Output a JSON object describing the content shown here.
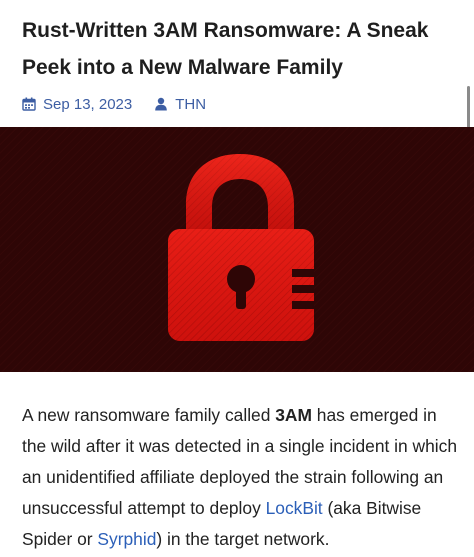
{
  "article": {
    "title_line1": "Rust-Written 3AM Ransomware: A Sneak",
    "title_line2": "Peek into a New Malware Family",
    "date": "Sep 13, 2023",
    "author": "THN",
    "date_icon": "calendar-icon",
    "author_icon": "user-icon"
  },
  "hero": {
    "icon": "padlock-icon",
    "background": "#2e0606",
    "lock_color": "#e0140f"
  },
  "paragraph": {
    "part1": "A new ransomware family called ",
    "bold1": "3AM",
    "part2": " has emerged in the wild after it was detected in a single incident in which an unidentified affiliate deployed the strain following an unsuccessful attempt to deploy ",
    "link1": "LockBit",
    "part3": " (aka Bitwise Spider or ",
    "link2": "Syrphid",
    "part4": ") in the target network."
  },
  "colors": {
    "link": "#2b5fb8",
    "meta": "#3d5ea3",
    "title": "#1f1f1f"
  }
}
